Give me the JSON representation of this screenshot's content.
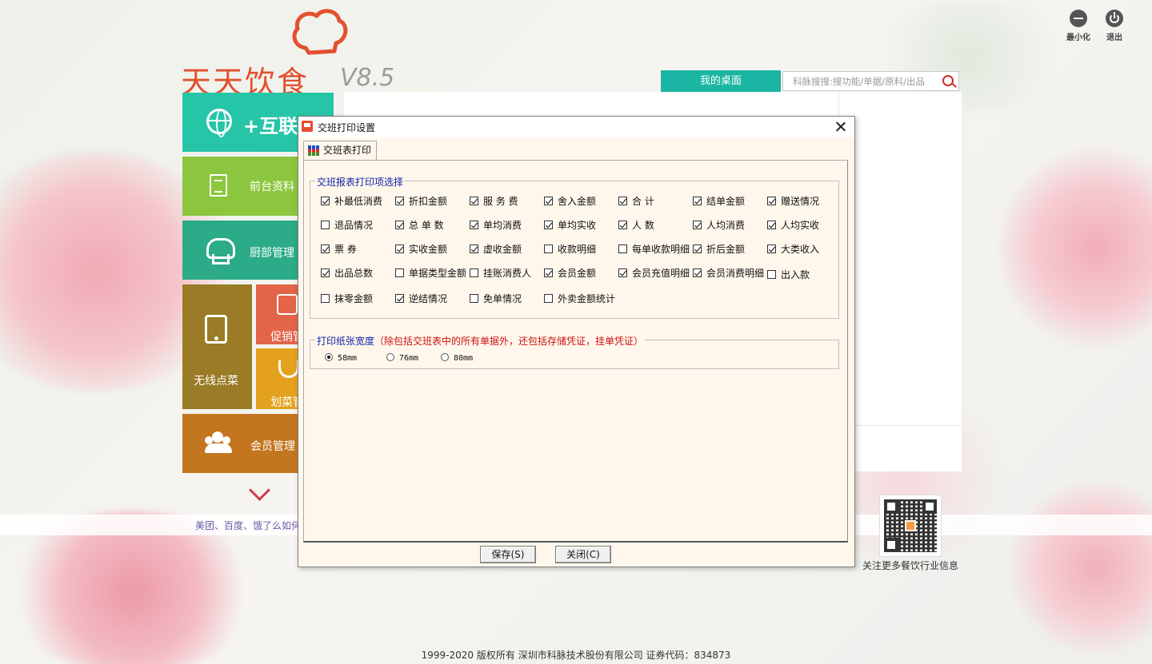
{
  "window_controls": {
    "minimize": "最小化",
    "exit": "退出"
  },
  "logo": {
    "name": "天天饮食",
    "version": "V8.5"
  },
  "desk": {
    "tab": "我的桌面",
    "search_placeholder": "科脉搜搜:搜功能/单据/原料/出品"
  },
  "tiles": {
    "internet": "+互联网",
    "front": "前台资料",
    "kitchen": "厨部管理",
    "wireless": "无线点菜",
    "promo": "促销管",
    "dish": "划菜管",
    "member": "会员管理"
  },
  "news_line": "美团、百度、饿了么如何",
  "qr_caption": "关注更多餐饮行业信息",
  "footer": "1999-2020  版权所有  深圳市科脉技术股份有限公司  证券代码：834873",
  "dialog": {
    "title": "交班打印设置",
    "tab": "交班表打印",
    "group1_title": "交班报表打印项选择",
    "options": [
      [
        {
          "label": "补最低消费",
          "checked": true
        },
        {
          "label": "折扣金额",
          "checked": true
        },
        {
          "label": "服 务 费",
          "checked": true
        },
        {
          "label": "舍入金额",
          "checked": true
        },
        {
          "label": "合    计",
          "checked": true
        },
        {
          "label": "结单金额",
          "checked": true
        },
        {
          "label": "赠送情况",
          "checked": true
        }
      ],
      [
        {
          "label": "退品情况",
          "checked": false
        },
        {
          "label": "总 单 数",
          "checked": true
        },
        {
          "label": "单均消费",
          "checked": true
        },
        {
          "label": "单均实收",
          "checked": true
        },
        {
          "label": "人    数",
          "checked": true
        },
        {
          "label": "人均消费",
          "checked": true
        },
        {
          "label": "人均实收",
          "checked": true
        }
      ],
      [
        {
          "label": "票    券",
          "checked": true
        },
        {
          "label": "实收金额",
          "checked": true
        },
        {
          "label": "虚收金额",
          "checked": true
        },
        {
          "label": "收款明细",
          "checked": false
        },
        {
          "label": "每单收款明细",
          "checked": false
        },
        {
          "label": "折后金额",
          "checked": true
        },
        {
          "label": "大类收入",
          "checked": true
        }
      ],
      [
        {
          "label": "出品总数",
          "checked": true
        },
        {
          "label": "单据类型金额",
          "checked": false
        },
        {
          "label": "挂账消费人",
          "checked": false
        },
        {
          "label": "会员金额",
          "checked": true
        },
        {
          "label": "会员充值明细",
          "checked": true
        },
        {
          "label": "会员消费明细",
          "checked": true
        },
        {
          "label": "出入款",
          "checked": false
        }
      ],
      [
        {
          "label": "抹零金额",
          "checked": false
        },
        {
          "label": "逆结情况",
          "checked": true
        },
        {
          "label": "免单情况",
          "checked": false
        },
        {
          "label": "外卖金额统计",
          "checked": false
        }
      ]
    ],
    "group2_title": "打印纸张宽度",
    "group2_note": "（除包括交班表中的所有单据外，还包括存储凭证，挂单凭证）",
    "paper_widths": [
      {
        "label": "58mm",
        "selected": true
      },
      {
        "label": "76mm",
        "selected": false
      },
      {
        "label": "80mm",
        "selected": false
      }
    ],
    "save_label": "保存(S)",
    "close_label": "关闭(C)"
  }
}
